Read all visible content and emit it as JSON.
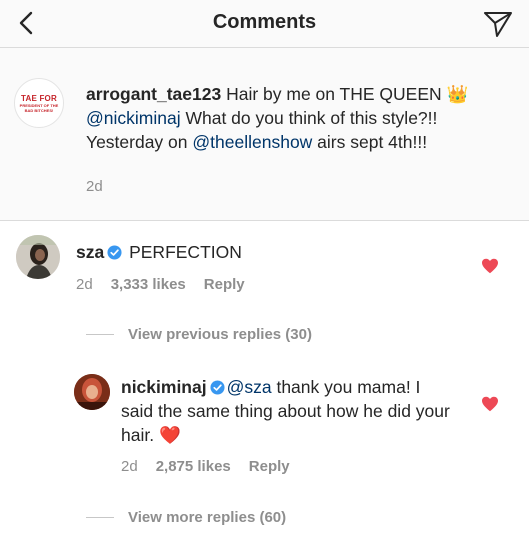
{
  "header": {
    "title": "Comments",
    "back_icon": "chevron-left-icon",
    "send_icon": "paper-plane-icon"
  },
  "caption": {
    "avatar_line1": "TAE FOR",
    "avatar_line2": "PRESIDENT OF THE",
    "avatar_line3": "BAD BITCHES!",
    "username": "arrogant_tae123",
    "text_part1": " Hair by me on THE QUEEN ",
    "crown_emoji": "👑",
    "mention1": "@nickiminaj",
    "text_part2": "  What do you think of this style?!! Yesterday on ",
    "mention2": "@theellenshow",
    "text_part3": " airs sept 4th!!!",
    "time": "2d"
  },
  "comments": [
    {
      "username": "sza",
      "text": " PERFECTION",
      "time": "2d",
      "likes": "3,333 likes",
      "reply_label": "Reply",
      "liked": true
    },
    {
      "username": "nickiminaj",
      "mention": "@sza",
      "text": " thank you mama! I said the same thing about how he did your hair. ",
      "heart_emoji": "❤️",
      "time": "2d",
      "likes": "2,875 likes",
      "reply_label": "Reply",
      "liked": true
    }
  ],
  "threads": {
    "view_previous": "View previous replies (30)",
    "view_more": "View more replies (60)"
  },
  "colors": {
    "header_bg": "#fafafa",
    "divider": "#dbdbdb",
    "mention": "#003569",
    "muted": "#8e8e8e",
    "heart": "#ed4956",
    "verified": "#3897f0"
  }
}
